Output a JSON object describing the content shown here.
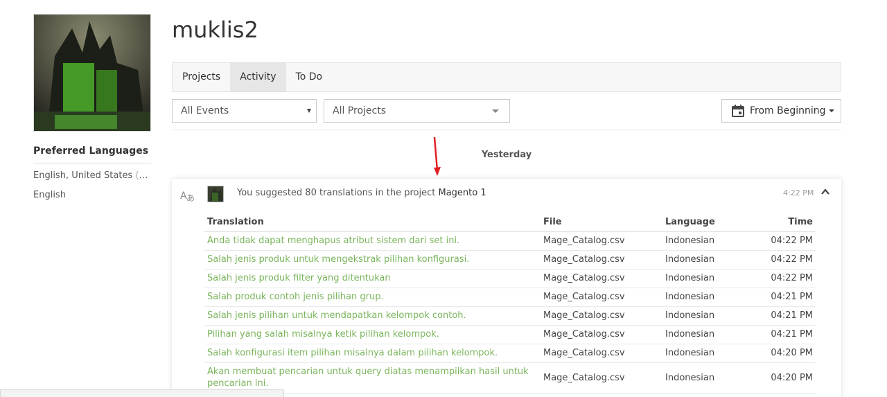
{
  "profile": {
    "username": "muklis2",
    "preferred_languages_title": "Preferred Languages",
    "languages": [
      {
        "name": "English, United States",
        "note": "(nat..."
      },
      {
        "name": "English",
        "note": ""
      }
    ]
  },
  "tabs": [
    {
      "label": "Projects",
      "active": false
    },
    {
      "label": "Activity",
      "active": true
    },
    {
      "label": "To Do",
      "active": false
    }
  ],
  "filters": {
    "events_value": "All Events",
    "projects_value": "All Projects",
    "range_label": "From Beginning"
  },
  "day_label": "Yesterday",
  "activity": {
    "summary_prefix": "You suggested 80 translations in the project ",
    "project": "Magento 1",
    "time": "4:22 PM",
    "columns": [
      "Translation",
      "File",
      "Language",
      "Time"
    ],
    "rows": [
      {
        "translation": "Anda tidak dapat menghapus atribut sistem dari set ini.",
        "file": "Mage_Catalog.csv",
        "language": "Indonesian",
        "time": "04:22 PM"
      },
      {
        "translation": "Salah jenis produk untuk mengekstrak pilihan konfigurasi.",
        "file": "Mage_Catalog.csv",
        "language": "Indonesian",
        "time": "04:22 PM"
      },
      {
        "translation": "Salah jenis produk filter yang ditentukan",
        "file": "Mage_Catalog.csv",
        "language": "Indonesian",
        "time": "04:22 PM"
      },
      {
        "translation": "Salah produk contoh jenis pilihan grup.",
        "file": "Mage_Catalog.csv",
        "language": "Indonesian",
        "time": "04:21 PM"
      },
      {
        "translation": "Salah jenis pilihan untuk mendapatkan kelompok contoh.",
        "file": "Mage_Catalog.csv",
        "language": "Indonesian",
        "time": "04:21 PM"
      },
      {
        "translation": "Pilihan yang salah misalnya ketik pilihan kelompok.",
        "file": "Mage_Catalog.csv",
        "language": "Indonesian",
        "time": "04:21 PM"
      },
      {
        "translation": "Salah konfigurasi item pilihan misalnya dalam pilihan kelompok.",
        "file": "Mage_Catalog.csv",
        "language": "Indonesian",
        "time": "04:20 PM"
      },
      {
        "translation": "Akan membuat pencarian untuk query diatas menampilkan hasil untuk pencarian ini.",
        "file": "Mage_Catalog.csv",
        "language": "Indonesian",
        "time": "04:20 PM"
      }
    ]
  },
  "status_url": "",
  "colors": {
    "link_green": "#7ab55c",
    "tab_active_bg": "#e6e6e6",
    "annotation_arrow": "#e02020"
  },
  "icons": {
    "translate": "translate-icon",
    "calendar": "calendar-icon",
    "collapse": "chevron-up-icon"
  }
}
